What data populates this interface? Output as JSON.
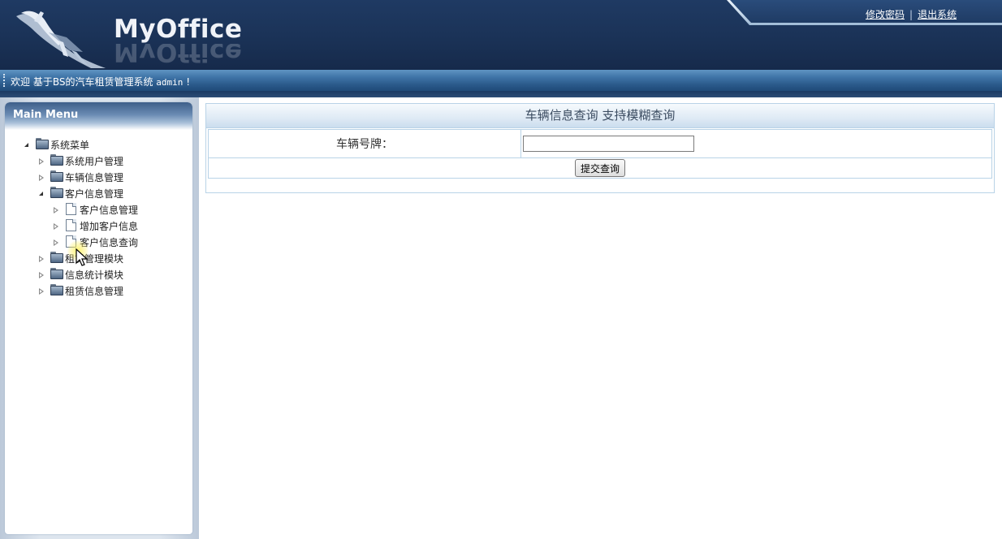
{
  "header": {
    "logo_text": "MyOffice",
    "links": {
      "change_password": "修改密码",
      "separator": "|",
      "logout": "退出系统"
    }
  },
  "welcome": {
    "prefix": "欢迎 基于BS的汽车租赁管理系统 ",
    "user": "admin",
    "suffix": " !"
  },
  "sidebar": {
    "title": "Main Menu",
    "tree": [
      {
        "label": "系统菜单",
        "type": "folder",
        "state": "expanded"
      },
      {
        "label": "系统用户管理",
        "type": "folder",
        "state": "collapsed"
      },
      {
        "label": "车辆信息管理",
        "type": "folder",
        "state": "collapsed"
      },
      {
        "label": "客户信息管理",
        "type": "folder",
        "state": "expanded"
      },
      {
        "label": "客户信息管理",
        "type": "page"
      },
      {
        "label": "增加客户信息",
        "type": "page"
      },
      {
        "label": "客户信息查询",
        "type": "page"
      },
      {
        "label": "租赁管理模块",
        "type": "folder",
        "state": "collapsed"
      },
      {
        "label": "信息统计模块",
        "type": "folder",
        "state": "collapsed"
      },
      {
        "label": "租赁信息管理",
        "type": "folder",
        "state": "collapsed"
      }
    ]
  },
  "main": {
    "title": "车辆信息查询  支持模糊查询",
    "form": {
      "plate_label": "车辆号牌：",
      "plate_value": "",
      "submit_label": "提交查询"
    }
  },
  "colors": {
    "header_bg": "#1f3a63",
    "welcome_bar": "#3f74a7",
    "border": "#b9d3e7",
    "title_text": "#3a4b60"
  }
}
